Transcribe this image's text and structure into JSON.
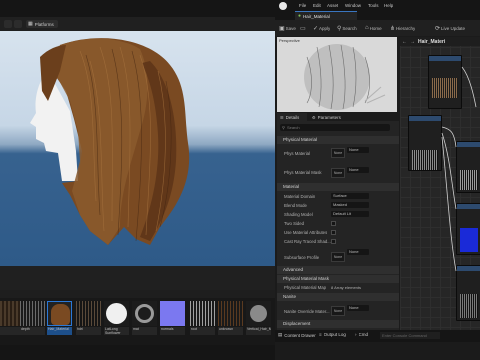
{
  "viewport": {
    "toolbar_label": "Platforms"
  },
  "menu": {
    "items": [
      "File",
      "Edit",
      "Asset",
      "Window",
      "Tools",
      "Help"
    ]
  },
  "tab": {
    "title": "Hair_Material"
  },
  "toolbar": {
    "save": "Save",
    "apply": "Apply",
    "search": "Search",
    "home": "Home",
    "hierarchy": "Hierarchy",
    "live_update": "Live Update"
  },
  "preview": {
    "label": "Perspective"
  },
  "graph": {
    "title": "Hair_Materi"
  },
  "details": {
    "tab_details": "Details",
    "tab_parameters": "Parameters",
    "search_placeholder": "Search",
    "sections": {
      "physical_material": "Physical Material",
      "material": "Material",
      "advanced": "Advanced",
      "physical_material_mask": "Physical Material Mask",
      "nanite": "Nanite",
      "displacement": "Displacement"
    },
    "rows": {
      "phys_material": "Phys Material",
      "phys_material_mask": "Phys Material Mask",
      "material_domain": "Material Domain",
      "blend_mode": "Blend Mode",
      "shading_model": "Shading Model",
      "two_sided": "Two Sided",
      "use_material_attributes": "Use Material Attributes",
      "cast_ray_traced_shadows": "Cast Ray Traced Shad...",
      "subsurface_profile": "Subsurface Profile",
      "physical_material_map": "Physical Material Map",
      "nanite_override_material": "Nanite Override Mater..."
    },
    "values": {
      "phys_material": "None",
      "phys_material_mask": "None",
      "material_domain": "Surface",
      "blend_mode": "Masked",
      "shading_model": "Default Lit",
      "subsurface_profile": "None",
      "physical_material_map": "8 Array elements",
      "nanite_override_material": "None",
      "swatch_label": "None"
    }
  },
  "status": {
    "content_drawer": "Content Drawer",
    "output_log": "Output Log",
    "cmd": "Cmd",
    "cmd_placeholder": "Enter Console Command"
  },
  "content": {
    "items": [
      {
        "label": ""
      },
      {
        "label": "depth"
      },
      {
        "label": "Hair_Material"
      },
      {
        "label": "hdri"
      },
      {
        "label": "LatLong Sunflower"
      },
      {
        "label": "mat"
      },
      {
        "label": "normals"
      },
      {
        "label": "root"
      },
      {
        "label": "unknown"
      },
      {
        "label": "Vertical_Hair_Master"
      }
    ]
  },
  "colors": {
    "accent": "#2d4a6e",
    "sky": "#c6d6e6",
    "ocean": "#2e5a88",
    "hair": "#7a4a22"
  }
}
